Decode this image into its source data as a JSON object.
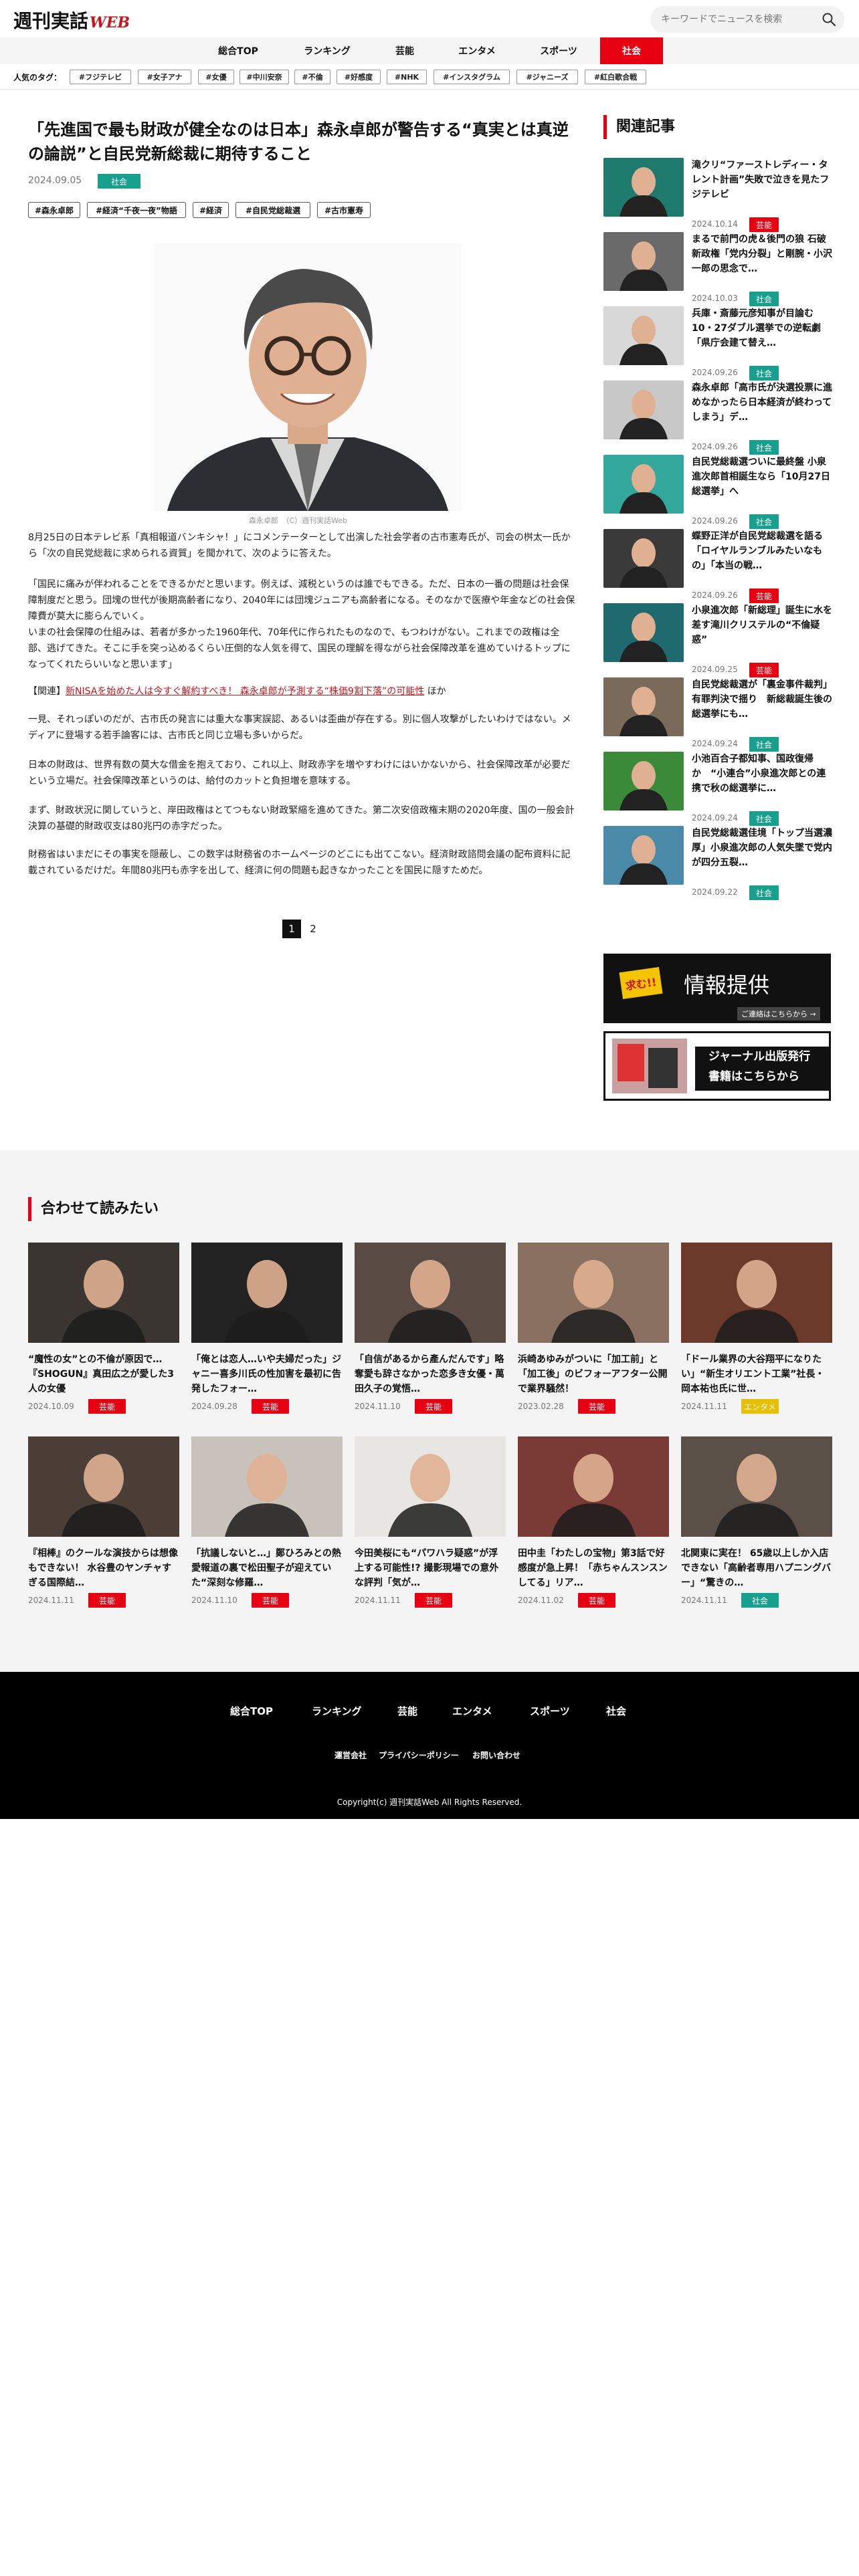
{
  "header": {
    "logo_main": "週刊実話",
    "logo_sub": "WEB",
    "search_placeholder": "キーワードでニュースを検索"
  },
  "nav": {
    "items": [
      "総合TOP",
      "ランキング",
      "芸能",
      "エンタメ",
      "スポーツ",
      "社会"
    ],
    "active_index": 5
  },
  "popular_tags": {
    "label": "人気のタグ：",
    "tags": [
      "#フジテレビ",
      "#女子アナ",
      "#女優",
      "#中川安奈",
      "#不倫",
      "#好感度",
      "#NHK",
      "#インスタグラム",
      "#ジャニーズ",
      "#紅白歌合戦"
    ]
  },
  "article": {
    "title": "「先進国で最も財政が健全なのは日本」森永卓郎が警告する“真実とは真逆の論説”と自民党新総裁に期待すること",
    "date": "2024.09.05",
    "category": "社会",
    "tags": [
      "#森永卓郎",
      "#経済“千夜一夜”物語",
      "#経済",
      "#自民党総裁選",
      "#古市憲寿"
    ],
    "image_caption": "森永卓郎　（C）週刊実話Web",
    "paragraphs": [
      "8月25日の日本テレビ系「真相報道バンキシャ！」にコメンテーターとして出演した社会学者の古市憲寿氏が、司会の桝太一氏から「次の自民党総裁に求められる資質」を聞かれて、次のように答えた。",
      "「国民に痛みが伴われることをできるかだと思います。例えば、減税というのは誰でもできる。ただ、日本の一番の問題は社会保障制度だと思う。団塊の世代が後期高齢者になり、2040年には団塊ジュニアも高齢者になる。そのなかで医療や年金などの社会保障費が莫大に膨らんでいく。",
      "いまの社会保障の仕組みは、若者が多かった1960年代、70年代に作られたものなので、もつわけがない。これまでの政権は全部、逃げてきた。そこに手を突っ込めるくらい圧倒的な人気を得て、国民の理解を得ながら社会保障改革を進めていけるトップになってくれたらいいなと思います」",
      "一見、それっぽいのだが、古市氏の発言には重大な事実誤認、あるいは歪曲が存在する。別に個人攻撃がしたいわけではない。メディアに登場する若手論客には、古市氏と同じ立場も多いからだ。",
      "日本の財政は、世界有数の莫大な借金を抱えており、これ以上、財政赤字を増やすわけにはいかないから、社会保障改革が必要だという立場だ。社会保障改革というのは、給付のカットと負担増を意味する。",
      "まず、財政状況に関していうと、岸田政権はとてつもない財政緊縮を進めてきた。第二次安倍政権末期の2020年度、国の一般会計決算の基礎的財政収支は80兆円の赤字だった。",
      "財務省はいまだにその事実を隠蔽し、この数字は財務省のホームページのどこにも出てこない。経済財政諮問会議の配布資料に記載されているだけだ。年間80兆円も赤字を出して、経済に何の問題も起きなかったことを国民に隠すためだ。"
    ],
    "related_prefix": "【関連】",
    "related_link": "新NISAを始めた人は今すぐ解約すべき！ 森永卓郎が予測する“株価9割下落”の可能性",
    "related_suffix": "ほか",
    "pages": [
      "1",
      "2"
    ],
    "current_page": "1"
  },
  "sidebar": {
    "heading": "関連記事",
    "items": [
      {
        "title": "滝クリ“ファーストレディー・タレント計画”失敗で泣きを見たフジテレビ",
        "date": "2024.10.14",
        "category": "芸能"
      },
      {
        "title": "まるで前門の虎＆後門の狼 石破新政権「党内分裂」と剛腕・小沢一郎の思念で…",
        "date": "2024.10.03",
        "category": "社会"
      },
      {
        "title": "兵庫・斎藤元彦知事が目論む10・27ダブル選挙での逆転劇「県庁会建て替え…",
        "date": "2024.09.26",
        "category": "社会"
      },
      {
        "title": "森永卓郎「高市氏が決選投票に進めなかったら日本経済が終わってしまう」デ…",
        "date": "2024.09.26",
        "category": "社会"
      },
      {
        "title": "自民党総裁選ついに最終盤 小泉進次郎首相誕生なら「10月27日総選挙」へ",
        "date": "2024.09.26",
        "category": "社会"
      },
      {
        "title": "蝶野正洋が自民党総裁選を語る「ロイヤルランブルみたいなもの」「本当の戦…",
        "date": "2024.09.26",
        "category": "芸能"
      },
      {
        "title": "小泉進次郎「新総理」誕生に水を差す滝川クリステルの“不倫疑惑”",
        "date": "2024.09.25",
        "category": "芸能"
      },
      {
        "title": "自民党総裁選が「裏金事件裁判」有罪判決で揺り　新総裁誕生後の総選挙にも…",
        "date": "2024.09.24",
        "category": "社会"
      },
      {
        "title": "小池百合子都知事、国政復帰か　“小連合”小泉進次郎との連携で秋の総選挙に…",
        "date": "2024.09.24",
        "category": "社会"
      },
      {
        "title": "自民党総裁選佳境「トップ当選濃厚」小泉進次郎の人気失墜で党内が四分五裂…",
        "date": "2024.09.22",
        "category": "社会"
      }
    ],
    "banner1_tag": "求む!!",
    "banner1_text": "情報提供",
    "banner1_sub": "ご連絡はこちらから →",
    "banner2_line1": "ジャーナル出版発行",
    "banner2_line2": "書籍はこちらから"
  },
  "more": {
    "heading": "合わせて読みたい",
    "cards": [
      {
        "title": "“魔性の女”との不倫が原因で…『SHOGUN』真田広之が愛した3人の女優",
        "date": "2024.10.09",
        "category": "芸能",
        "img": "#3a3530"
      },
      {
        "title": "「俺とは恋人…いや夫婦だった」ジャニー喜多川氏の性加害を最初に告発したフォー…",
        "date": "2024.09.28",
        "category": "芸能",
        "img": "#222222"
      },
      {
        "title": "「自信があるから產んだんです」略奪愛も辞さなかった恋多き女優・萬田久子の覚悟…",
        "date": "2024.11.10",
        "category": "芸能",
        "img": "#5a4a44"
      },
      {
        "title": "浜崎あゆみがついに「加工前」と「加工後」のビフォーアフター公開で業界騒然！",
        "date": "2023.02.28",
        "category": "芸能",
        "img": "#8a7060"
      },
      {
        "title": "「ドール業界の大谷翔平になりたい」“新生オリエント工業”社長・岡本祐也氏に世…",
        "date": "2024.11.11",
        "category": "エンタメ",
        "img": "#6b3a2a"
      },
      {
        "title": "『相棒』のクールな演技からは想像もできない！ 水谷豊のヤンチャすぎる国際結…",
        "date": "2024.11.11",
        "category": "芸能",
        "img": "#4a3e36"
      },
      {
        "title": "「抗議しないと…」鄭ひろみとの熱愛報道の裏で松田聖子が迎えていた“深刻な修羅…",
        "date": "2024.11.10",
        "category": "芸能",
        "img": "#c9c2ba"
      },
      {
        "title": "今田美桜にも“パワハラ疑惑”が浮上する可能性!? 撮影現場での意外な評判「気が…",
        "date": "2024.11.11",
        "category": "芸能",
        "img": "#e8e6e2"
      },
      {
        "title": "田中圭「わたしの宝物」第3話で好感度が急上昇！「赤ちゃんスンスンしてる」リア…",
        "date": "2024.11.02",
        "category": "芸能",
        "img": "#7a3a36"
      },
      {
        "title": "北関東に実在！ 65歳以上しか入店できない「高齢者専用ハプニングバー」“驚きの…",
        "date": "2024.11.11",
        "category": "社会",
        "img": "#5a5048"
      }
    ]
  },
  "footer": {
    "nav": [
      "総合TOP",
      "ランキング",
      "芸能",
      "エンタメ",
      "スポーツ",
      "社会"
    ],
    "links": [
      "運営会社",
      "プライバシーポリシー",
      "お問い合わせ"
    ],
    "copyright": "Copyright(c) 週刊実話Web All Rights Reserved."
  },
  "colors": {
    "accent": "#e60012",
    "shakai": "#17a08e",
    "geino": "#e60012",
    "entame": "#e6c000"
  }
}
